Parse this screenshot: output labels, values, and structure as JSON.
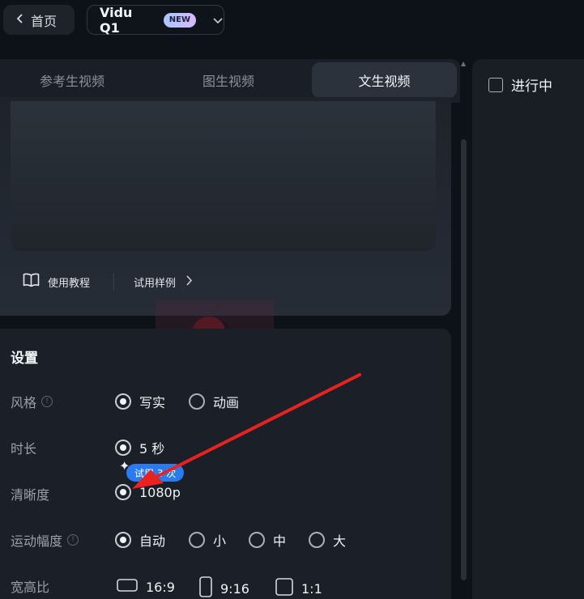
{
  "topbar": {
    "back_label": "首页",
    "model_name": "Vidu Q1",
    "model_badge": "NEW"
  },
  "tabs": [
    {
      "label": "参考生视频",
      "active": false
    },
    {
      "label": "图生视频",
      "active": false
    },
    {
      "label": "文生视频",
      "active": true
    }
  ],
  "prompt": {
    "tutorial_label": "使用教程",
    "examples_label": "试用样例"
  },
  "settings": {
    "title": "设置",
    "style": {
      "label": "风格",
      "options": [
        "写实",
        "动画"
      ],
      "selected": "写实"
    },
    "duration": {
      "label": "时长",
      "options": [
        "5 秒"
      ],
      "selected": "5 秒"
    },
    "resolution": {
      "label": "清晰度",
      "options": [
        "1080p"
      ],
      "selected": "1080p",
      "trial_badge": "试用 3 次"
    },
    "motion": {
      "label": "运动幅度",
      "options": [
        "自动",
        "小",
        "中",
        "大"
      ],
      "selected": "自动"
    },
    "aspect": {
      "label": "宽高比",
      "options": [
        "16:9",
        "9:16",
        "1:1"
      ]
    }
  },
  "right_panel": {
    "in_progress_label": "进行中",
    "in_progress_checked": false
  },
  "colors": {
    "background": "#0d1219",
    "panel": "#1b2028",
    "accent_blue": "#2b7bf0",
    "annotation_arrow": "#e8231f"
  }
}
